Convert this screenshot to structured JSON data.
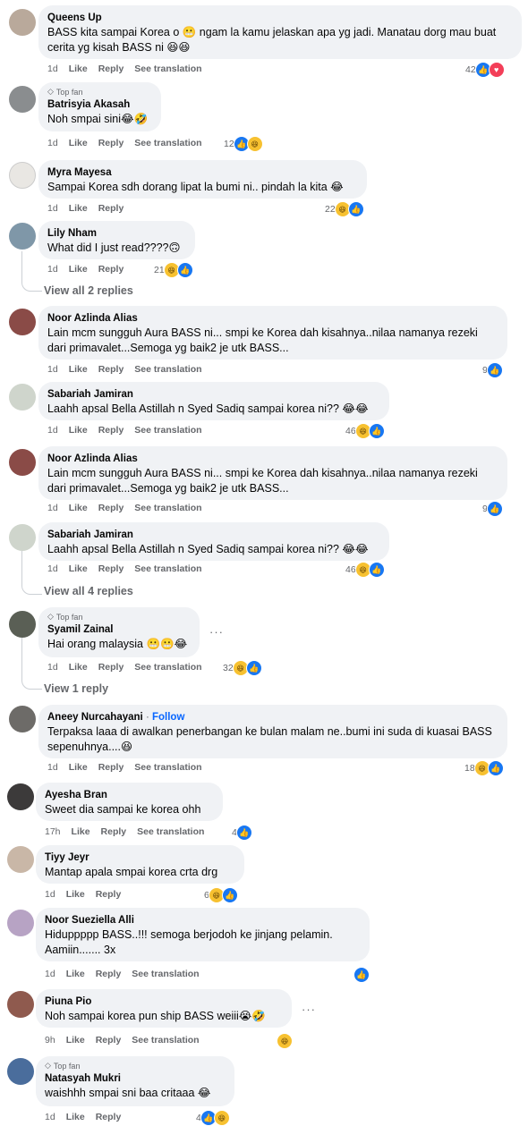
{
  "comments": [
    {
      "author": "Queens Up",
      "text": "BASS kita sampai Korea o 😬 ngam la kamu jelaskan apa yg jadi. Manatau dorg mau buat cerita yg kisah BASS ni 😆😆",
      "time": "1d",
      "like": "Like",
      "reply": "Reply",
      "translate": "See translation",
      "count": "42",
      "reactions": [
        "like",
        "love"
      ]
    },
    {
      "badge": "Top fan",
      "author": "Batrisyia Akasah",
      "text": "Noh smpai sini😂🤣",
      "time": "1d",
      "like": "Like",
      "reply": "Reply",
      "translate": "See translation",
      "count": "12",
      "reactions": [
        "like",
        "haha"
      ]
    },
    {
      "author": "Myra Mayesa",
      "text": "Sampai Korea sdh dorang lipat la bumi ni.. pindah la kita 😂",
      "time": "1d",
      "like": "Like",
      "reply": "Reply",
      "count": "22",
      "reactions": [
        "haha",
        "like"
      ]
    },
    {
      "author": "Lily Nham",
      "text": "What did I just read????🙃",
      "time": "1d",
      "like": "Like",
      "reply": "Reply",
      "count": "21",
      "reactions": [
        "haha",
        "like"
      ]
    },
    {
      "author": "Noor Azlinda Alias",
      "text": "Lain mcm sungguh Aura BASS ni... smpi ke Korea dah kisahnya..nilaa namanya rezeki dari primavalet...Semoga yg baik2 je utk BASS...",
      "time": "1d",
      "like": "Like",
      "reply": "Reply",
      "translate": "See translation",
      "count": "9",
      "reactions": [
        "like"
      ]
    },
    {
      "author": "Sabariah Jamiran",
      "text": "Laahh apsal Bella Astillah n Syed Sadiq sampai korea ni?? 😂😂",
      "time": "1d",
      "like": "Like",
      "reply": "Reply",
      "translate": "See translation",
      "count": "46",
      "reactions": [
        "haha",
        "like"
      ]
    },
    {
      "author": "Noor Azlinda Alias",
      "text": "Lain mcm sungguh Aura BASS ni... smpi ke Korea dah kisahnya..nilaa namanya rezeki dari primavalet...Semoga yg baik2 je utk BASS...",
      "time": "1d",
      "like": "Like",
      "reply": "Reply",
      "translate": "See translation",
      "count": "9",
      "reactions": [
        "like"
      ]
    },
    {
      "author": "Sabariah Jamiran",
      "text": "Laahh apsal Bella Astillah n Syed Sadiq sampai korea ni?? 😂😂",
      "time": "1d",
      "like": "Like",
      "reply": "Reply",
      "translate": "See translation",
      "count": "46",
      "reactions": [
        "haha",
        "like"
      ]
    },
    {
      "badge": "Top fan",
      "author": "Syamil Zainal",
      "text": "Hai orang malaysia 😬😬😂",
      "time": "1d",
      "like": "Like",
      "reply": "Reply",
      "translate": "See translation",
      "count": "32",
      "reactions": [
        "haha",
        "like"
      ],
      "more": "···"
    },
    {
      "author": "Aneey Nurcahayani",
      "follow": "Follow",
      "text": "Terpaksa laaa di awalkan penerbangan ke bulan malam ne..bumi ini suda di kuasai BASS sepenuhnya....😆",
      "time": "1d",
      "like": "Like",
      "reply": "Reply",
      "translate": "See translation",
      "count": "18",
      "reactions": [
        "haha",
        "like"
      ]
    },
    {
      "author": "Ayesha Bran",
      "text": "Sweet dia sampai ke korea ohh",
      "time": "17h",
      "like": "Like",
      "reply": "Reply",
      "translate": "See translation",
      "count": "4",
      "reactions": [
        "like"
      ]
    },
    {
      "author": "Tiyy Jeyr",
      "text": "Mantap apala smpai korea crta drg",
      "time": "1d",
      "like": "Like",
      "reply": "Reply",
      "count": "6",
      "reactions": [
        "haha",
        "like"
      ]
    },
    {
      "author": "Noor Sueziella Alli",
      "text": "Hiduppppp BASS..!!! semoga berjodoh ke jinjang pelamin. Aamiin....... 3x",
      "time": "1d",
      "like": "Like",
      "reply": "Reply",
      "translate": "See translation",
      "count": "",
      "reactions": [
        "like"
      ]
    },
    {
      "author": "Piuna Pio",
      "text": "Noh sampai korea pun ship BASS weiii😭🤣",
      "time": "9h",
      "like": "Like",
      "reply": "Reply",
      "translate": "See translation",
      "count": "",
      "reactions": [
        "haha"
      ],
      "more": "···"
    },
    {
      "badge": "Top fan",
      "author": "Natasyah Mukri",
      "text": "waishhh smpai sni baa critaaa 😂",
      "time": "1d",
      "like": "Like",
      "reply": "Reply",
      "count": "4",
      "reactions": [
        "like",
        "haha"
      ]
    }
  ],
  "threads": {
    "view_all_2": "View all 2 replies",
    "view_all_4": "View all 4 replies",
    "view_1": "View 1 reply"
  },
  "colors": {
    "like": "#1877f2",
    "love": "#f33e58",
    "haha": "#f7c130",
    "link": "#0866ff"
  }
}
